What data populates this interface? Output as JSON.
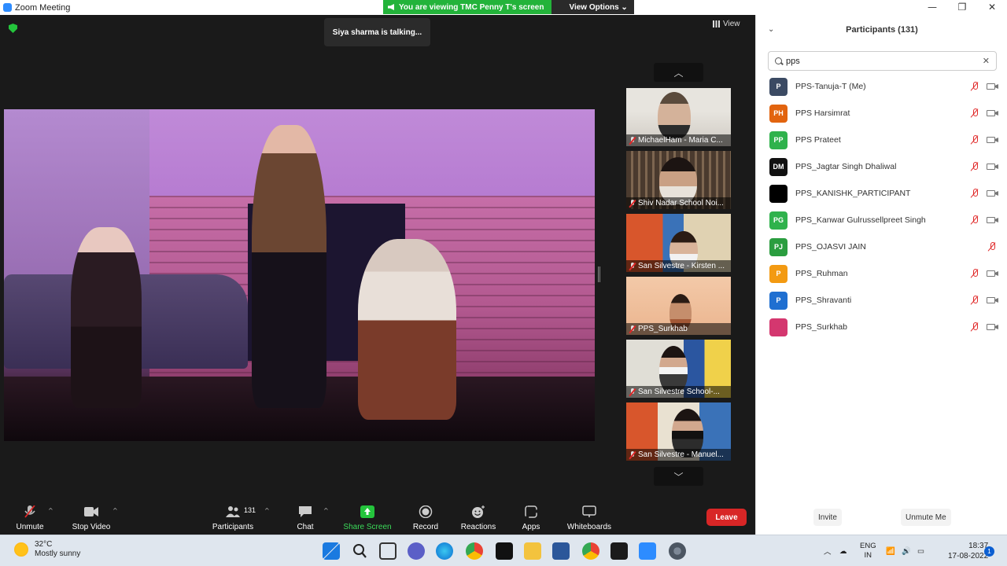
{
  "window": {
    "title": "Zoom Meeting",
    "minimize": "—",
    "restore": "❐",
    "close": "✕"
  },
  "banner": {
    "viewing": "You are viewing TMC Penny T's screen",
    "view_options": "View Options ⌄"
  },
  "meeting": {
    "talking": "Siya sharma is talking...",
    "view_label": "View",
    "scroll_up": "︿",
    "scroll_down": "﹀"
  },
  "thumbnails": [
    {
      "name": "MichaelHam - Maria C..."
    },
    {
      "name": "Shiv Nadar School Noi..."
    },
    {
      "name": "San Silvestre - Kirsten ..."
    },
    {
      "name": "PPS_Surkhab"
    },
    {
      "name": "San Silvestre School-..."
    },
    {
      "name": "San Silvestre - Manuel..."
    }
  ],
  "toolbar": {
    "unmute": "Unmute",
    "stop_video": "Stop Video",
    "participants": "Participants",
    "participants_count": "131",
    "chat": "Chat",
    "share_screen": "Share Screen",
    "record": "Record",
    "reactions": "Reactions",
    "apps": "Apps",
    "whiteboards": "Whiteboards",
    "leave": "Leave",
    "caret": "^"
  },
  "panel": {
    "title": "Participants (131)",
    "collapse": "⌄",
    "search_value": "pps",
    "clear": "✕",
    "participants": [
      {
        "initials": "P",
        "name": "PPS-Tanuja-T (Me)",
        "color": "#3b4a63",
        "video": true
      },
      {
        "initials": "PH",
        "name": "PPS Harsimrat",
        "color": "#e2640f",
        "video": true
      },
      {
        "initials": "PP",
        "name": "PPS Prateet",
        "color": "#2fb24c",
        "video": true
      },
      {
        "initials": "DM",
        "name": "PPS_Jagtar Singh Dhaliwal",
        "color": "#111111",
        "video": true
      },
      {
        "initials": "",
        "name": "PPS_KANISHK_PARTICIPANT",
        "color": "#000000",
        "video": true
      },
      {
        "initials": "PG",
        "name": "PPS_Kanwar Gulrussellpreet Singh",
        "color": "#2fb24c",
        "video": true
      },
      {
        "initials": "PJ",
        "name": "PPS_OJASVI JAIN",
        "color": "#2a9d3f",
        "video": false
      },
      {
        "initials": "P",
        "name": "PPS_Ruhman",
        "color": "#f39a12",
        "video": true
      },
      {
        "initials": "P",
        "name": "PPS_Shravanti",
        "color": "#1f6fd1",
        "video": true
      },
      {
        "initials": "",
        "name": "PPS_Surkhab",
        "color": "#d4376f",
        "video": true
      }
    ],
    "invite": "Invite",
    "unmute_me": "Unmute Me"
  },
  "taskbar": {
    "temp": "32°C",
    "weather": "Mostly sunny",
    "lang1": "ENG",
    "lang2": "IN",
    "time": "18:37",
    "date": "17-08-2022",
    "notifications": "1",
    "tray_caret": "︿"
  }
}
